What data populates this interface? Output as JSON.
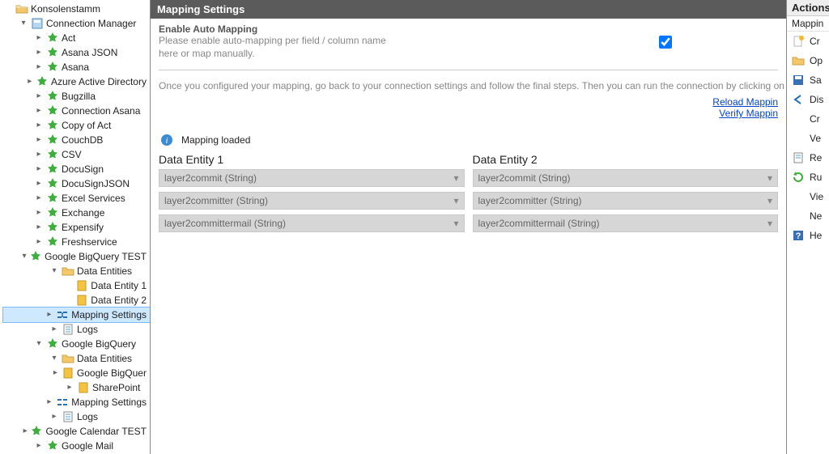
{
  "tree": {
    "root": "Konsolenstamm",
    "connMgr": "Connection Manager",
    "items": [
      "Act",
      "Asana JSON",
      "Asana",
      "Azure Active Directory",
      "Bugzilla",
      "Connection Asana",
      "Copy of Act",
      "CouchDB",
      "CSV",
      "DocuSign",
      "DocuSignJSON",
      "Excel Services",
      "Exchange",
      "Expensify",
      "Freshservice"
    ],
    "bigQueryTest": {
      "name": "Google BigQuery TEST",
      "dataEntities": "Data Entities",
      "entity1": "Data Entity 1",
      "entity2": "Data Entity 2",
      "mappingSettings": "Mapping Settings",
      "logs": "Logs"
    },
    "bigQuery": {
      "name": "Google BigQuery",
      "dataEntities": "Data Entities",
      "sub1": "Google BigQuer",
      "sub2": "SharePoint",
      "mappingSettings": "Mapping Settings",
      "logs": "Logs"
    },
    "calTest": "Google Calendar TEST",
    "gmail": "Google Mail"
  },
  "center": {
    "title": "Mapping Settings",
    "autoMap": {
      "head": "Enable Auto Mapping",
      "line1": "Please enable auto-mapping per field / column name",
      "line2": "here or map manually."
    },
    "instruction": "Once you configured your mapping, go back to your connection settings and follow the final steps. Then you can run the connection by clicking on 'Run now'",
    "reloadLink": "Reload Mappin",
    "verifyLink": "Verify Mappin",
    "loaded": "Mapping loaded",
    "entity1Title": "Data Entity 1",
    "entity2Title": "Data Entity 2",
    "chart_data": null,
    "mappings": [
      {
        "left": "layer2commit (String)",
        "right": "layer2commit (String)"
      },
      {
        "left": "layer2committer (String)",
        "right": "layer2committer (String)"
      },
      {
        "left": "layer2committermail (String)",
        "right": "layer2committermail (String)"
      }
    ]
  },
  "actions": {
    "title": "Actions",
    "heading": "Mappin",
    "items": [
      "Cr",
      "Op",
      "Sa",
      "Dis",
      "Cr",
      "Ve",
      "Re",
      "Ru",
      "Vie",
      "Ne",
      "He"
    ]
  }
}
